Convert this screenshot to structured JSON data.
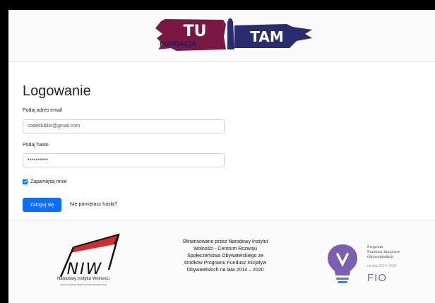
{
  "header": {
    "logo_tu": "TU",
    "logo_fundacja": "FUNDACJA",
    "logo_tam": "TAM"
  },
  "login": {
    "title": "Logowanie",
    "email_label": "Podaj adres email",
    "email_value": "codeitlublin@gmail.com",
    "password_label": "Podaj hasło",
    "password_value": "••••••••••",
    "remember_label": "Zapamiętaj mnie",
    "remember_checked": true,
    "submit_label": "Zaloguj się",
    "forgot_label": "Nie pamiętasz hasła?"
  },
  "footer": {
    "niw_logo_text": "NIW",
    "niw_name": "Narodowy Instytut Wolności",
    "niw_sub": "Centrum Rozwoju Społeczeństwa Obywatelskiego",
    "funding_lines": [
      "Sfinansowano przez Narodowy Instytut",
      "Wolności - Centrum Rozwoju",
      "Społeczeństwa Obywatelskiego ze",
      "środków Programu Fundusz Inicjatyw",
      "Obywatelskich na lata 2014 – 2020"
    ],
    "fio_lines": [
      "Program",
      "Fundusz Inicjatyw",
      "Obywatelskich"
    ],
    "fio_years": "na lata 2014–2020",
    "fio_name": "FIO"
  },
  "colors": {
    "primary": "#0d6efd",
    "logo_maroon": "#7a1742",
    "logo_navy": "#2a2c6e",
    "niw_red": "#d42b2b",
    "fio_purple": "#7b5fb0"
  }
}
